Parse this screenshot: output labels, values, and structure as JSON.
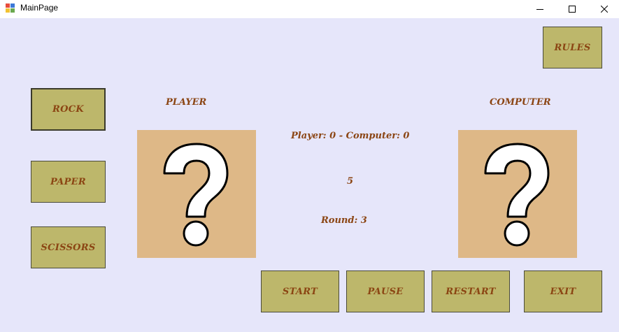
{
  "window": {
    "title": "MainPage"
  },
  "choices": {
    "rock": "ROCK",
    "paper": "PAPER",
    "scissors": "SCISSORS"
  },
  "labels": {
    "player": "PLAYER",
    "computer": "COMPUTER",
    "score": "Player: 0 - Computer: 0",
    "timer": "5",
    "round": "Round: 3"
  },
  "buttons": {
    "rules": "RULES",
    "start": "START",
    "pause": "PAUSE",
    "restart": "RESTART",
    "exit": "EXIT"
  },
  "colors": {
    "background": "#e6e6fa",
    "button": "#bdb76b",
    "text": "#8b4513",
    "panel": "#deb887"
  },
  "icons": {
    "player_choice": "question-mark-icon",
    "computer_choice": "question-mark-icon"
  }
}
